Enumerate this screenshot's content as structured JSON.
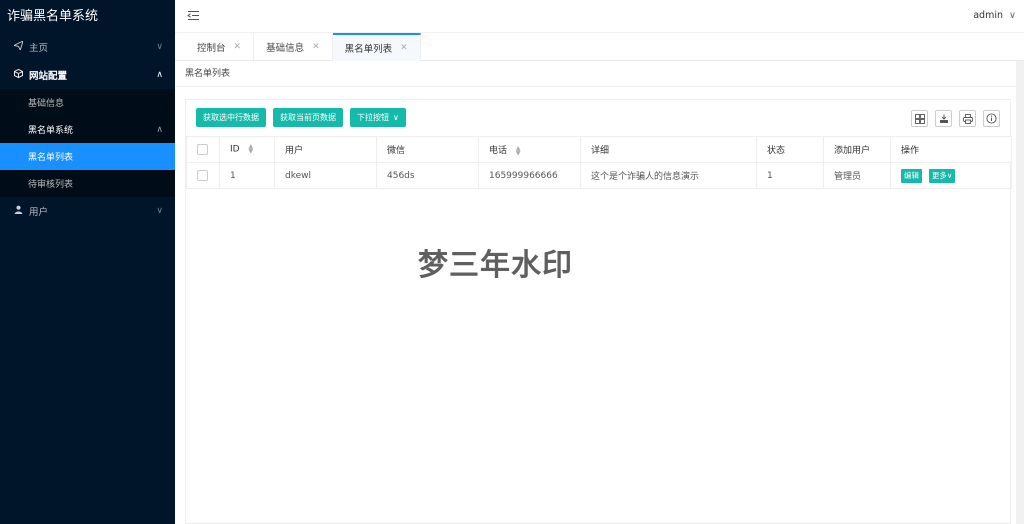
{
  "app": {
    "title": "诈骗黑名单系统"
  },
  "sidebar": {
    "items": [
      {
        "label": "主页",
        "icon": "paper-plane-icon",
        "arrow": "∨"
      },
      {
        "label": "网站配置",
        "icon": "cube-icon",
        "arrow": "∧"
      },
      {
        "label": "基础信息"
      },
      {
        "label": "黑名单系统",
        "arrow": "∧"
      },
      {
        "label": "黑名单列表"
      },
      {
        "label": "待审核列表"
      },
      {
        "label": "用户",
        "icon": "user-icon",
        "arrow": "∨"
      }
    ]
  },
  "header": {
    "user": "admin"
  },
  "tabs": [
    {
      "label": "控制台"
    },
    {
      "label": "基础信息"
    },
    {
      "label": "黑名单列表"
    }
  ],
  "breadcrumb": "黑名单列表",
  "toolbar": {
    "btn_get_selected": "获取选中行数据",
    "btn_get_page": "获取当前页数据",
    "btn_dropdown": "下拉按钮"
  },
  "table": {
    "headers": [
      "ID",
      "用户",
      "微信",
      "电话",
      "详细",
      "状态",
      "添加用户",
      "操作"
    ],
    "rows": [
      {
        "id": "1",
        "user": "dkewl",
        "wechat": "456ds",
        "phone": "165999966666",
        "detail": "这个是个诈骗人的信息演示",
        "status": "1",
        "added_by": "管理员",
        "edit": "编辑",
        "more": "更多"
      }
    ]
  },
  "watermark": "梦三年水印",
  "colors": {
    "sidebar_bg": "#001529",
    "active": "#1890ff",
    "button": "#16baaa"
  }
}
